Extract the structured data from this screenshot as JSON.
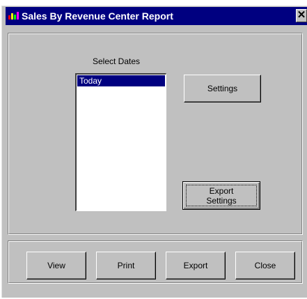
{
  "window": {
    "title": "Sales By Revenue Center Report",
    "close_glyph": "✕"
  },
  "dates": {
    "heading": "Select Dates",
    "items": [
      "Today"
    ],
    "selected_index": 0
  },
  "buttons": {
    "settings": "Settings",
    "export_settings_line1": "Export",
    "export_settings_line2": "Settings",
    "view": "View",
    "print": "Print",
    "export": "Export",
    "close": "Close"
  },
  "colors": {
    "titlebar": "#000080",
    "face": "#c0c0c0",
    "selection": "#000080"
  }
}
